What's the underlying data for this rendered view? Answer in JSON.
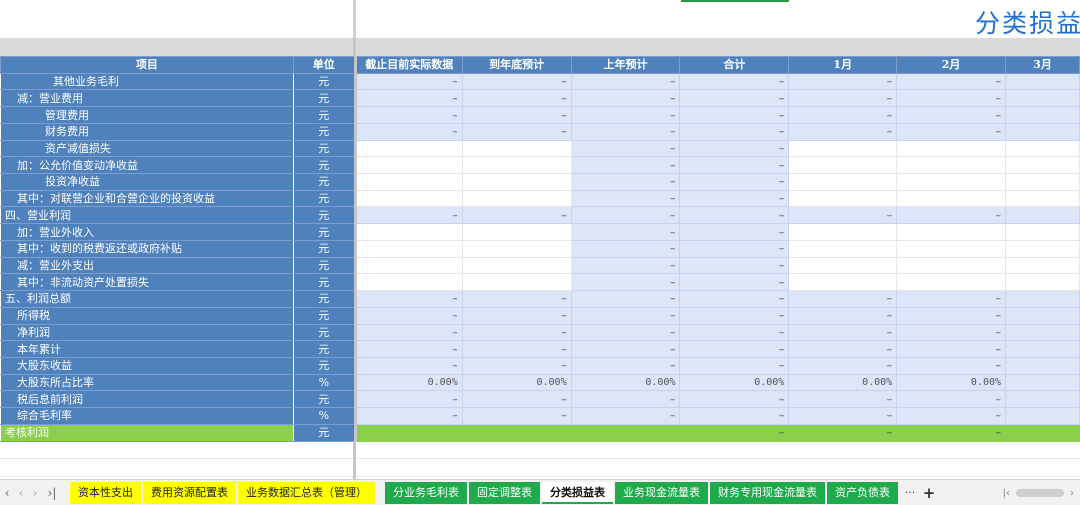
{
  "title": "分类损益",
  "columns": {
    "item": "项目",
    "unit": "单位",
    "data": [
      "截止目前实际数据",
      "到年底预计",
      "上年预计",
      "合计",
      "1月",
      "2月",
      "3月"
    ]
  },
  "rows": [
    {
      "label": "其他业务毛利",
      "unit": "元",
      "indent": "i1",
      "cells": [
        "–",
        "–",
        "–",
        "–",
        "–",
        "–",
        ""
      ],
      "fill": [
        "b",
        "b",
        "b",
        "b",
        "b",
        "b",
        "b"
      ]
    },
    {
      "label": "减：营业费用",
      "unit": "元",
      "indent": "i3",
      "cells": [
        "–",
        "–",
        "–",
        "–",
        "–",
        "–",
        ""
      ],
      "fill": [
        "b",
        "b",
        "b",
        "b",
        "b",
        "b",
        "b"
      ]
    },
    {
      "label": "管理费用",
      "unit": "元",
      "indent": "i2",
      "cells": [
        "–",
        "–",
        "–",
        "–",
        "–",
        "–",
        ""
      ],
      "fill": [
        "b",
        "b",
        "b",
        "b",
        "b",
        "b",
        "b"
      ]
    },
    {
      "label": "财务费用",
      "unit": "元",
      "indent": "i2",
      "cells": [
        "–",
        "–",
        "–",
        "–",
        "–",
        "–",
        ""
      ],
      "fill": [
        "b",
        "b",
        "b",
        "b",
        "b",
        "b",
        "b"
      ]
    },
    {
      "label": "资产减值损失",
      "unit": "元",
      "indent": "i2",
      "cells": [
        "",
        "",
        "–",
        "–",
        "",
        "",
        ""
      ],
      "fill": [
        "w",
        "w",
        "b",
        "b",
        "w",
        "w",
        "w"
      ]
    },
    {
      "label": "加：公允价值变动净收益",
      "unit": "元",
      "indent": "i3",
      "cells": [
        "",
        "",
        "–",
        "–",
        "",
        "",
        ""
      ],
      "fill": [
        "w",
        "w",
        "b",
        "b",
        "w",
        "w",
        "w"
      ]
    },
    {
      "label": "投资净收益",
      "unit": "元",
      "indent": "i2",
      "cells": [
        "",
        "",
        "–",
        "–",
        "",
        "",
        ""
      ],
      "fill": [
        "w",
        "w",
        "b",
        "b",
        "w",
        "w",
        "w"
      ]
    },
    {
      "label": "其中：对联营企业和合营企业的投资收益",
      "unit": "元",
      "indent": "i3",
      "cells": [
        "",
        "",
        "–",
        "–",
        "",
        "",
        ""
      ],
      "fill": [
        "w",
        "w",
        "b",
        "b",
        "w",
        "w",
        "w"
      ]
    },
    {
      "label": "四、营业利润",
      "unit": "元",
      "indent": "i0",
      "cells": [
        "–",
        "–",
        "–",
        "–",
        "–",
        "–",
        ""
      ],
      "fill": [
        "b",
        "b",
        "b",
        "b",
        "b",
        "b",
        "b"
      ]
    },
    {
      "label": "加：营业外收入",
      "unit": "元",
      "indent": "i3",
      "cells": [
        "",
        "",
        "–",
        "–",
        "",
        "",
        ""
      ],
      "fill": [
        "w",
        "w",
        "b",
        "b",
        "w",
        "w",
        "w"
      ]
    },
    {
      "label": "其中：收到的税费返还或政府补贴",
      "unit": "元",
      "indent": "i3",
      "cells": [
        "",
        "",
        "–",
        "–",
        "",
        "",
        ""
      ],
      "fill": [
        "w",
        "w",
        "b",
        "b",
        "w",
        "w",
        "w"
      ]
    },
    {
      "label": "减：营业外支出",
      "unit": "元",
      "indent": "i3",
      "cells": [
        "",
        "",
        "–",
        "–",
        "",
        "",
        ""
      ],
      "fill": [
        "w",
        "w",
        "b",
        "b",
        "w",
        "w",
        "w"
      ]
    },
    {
      "label": "其中：非流动资产处置损失",
      "unit": "元",
      "indent": "i3",
      "cells": [
        "",
        "",
        "–",
        "–",
        "",
        "",
        ""
      ],
      "fill": [
        "w",
        "w",
        "b",
        "b",
        "w",
        "w",
        "w"
      ]
    },
    {
      "label": "五、利润总额",
      "unit": "元",
      "indent": "i0",
      "cells": [
        "–",
        "–",
        "–",
        "–",
        "–",
        "–",
        ""
      ],
      "fill": [
        "b",
        "b",
        "b",
        "b",
        "b",
        "b",
        "b"
      ]
    },
    {
      "label": "所得税",
      "unit": "元",
      "indent": "i3",
      "cells": [
        "–",
        "–",
        "–",
        "–",
        "–",
        "–",
        ""
      ],
      "fill": [
        "b",
        "b",
        "b",
        "b",
        "b",
        "b",
        "b"
      ]
    },
    {
      "label": "净利润",
      "unit": "元",
      "indent": "i3",
      "cells": [
        "–",
        "–",
        "–",
        "–",
        "–",
        "–",
        ""
      ],
      "fill": [
        "b",
        "b",
        "b",
        "b",
        "b",
        "b",
        "b"
      ]
    },
    {
      "label": "本年累计",
      "unit": "元",
      "indent": "i3",
      "cells": [
        "–",
        "–",
        "–",
        "–",
        "–",
        "–",
        ""
      ],
      "fill": [
        "b",
        "b",
        "b",
        "b",
        "b",
        "b",
        "b"
      ]
    },
    {
      "label": "大股东收益",
      "unit": "元",
      "indent": "i3",
      "cells": [
        "–",
        "–",
        "–",
        "–",
        "–",
        "–",
        ""
      ],
      "fill": [
        "b",
        "b",
        "b",
        "b",
        "b",
        "b",
        "b"
      ]
    },
    {
      "label": "大股东所占比率",
      "unit": "%",
      "indent": "i3",
      "cells": [
        "0.00%",
        "0.00%",
        "0.00%",
        "0.00%",
        "0.00%",
        "0.00%",
        ""
      ],
      "fill": [
        "b",
        "b",
        "b",
        "b",
        "b",
        "b",
        "b"
      ]
    },
    {
      "label": "税后息前利润",
      "unit": "元",
      "indent": "i3",
      "cells": [
        "–",
        "–",
        "–",
        "–",
        "–",
        "–",
        ""
      ],
      "fill": [
        "b",
        "b",
        "b",
        "b",
        "b",
        "b",
        "b"
      ]
    },
    {
      "label": "综合毛利率",
      "unit": "%",
      "indent": "i3",
      "cells": [
        "–",
        "–",
        "–",
        "–",
        "–",
        "–",
        ""
      ],
      "fill": [
        "b",
        "b",
        "b",
        "b",
        "b",
        "b",
        "b"
      ]
    },
    {
      "label": "考核利润",
      "unit": "元",
      "indent": "i0",
      "cells": [
        "",
        "",
        "",
        "–",
        "–",
        "–",
        ""
      ],
      "fill": [
        "g",
        "g",
        "g",
        "g",
        "g",
        "g",
        "g"
      ]
    }
  ],
  "tabs": [
    {
      "label": "资本性支出",
      "style": "yellow"
    },
    {
      "label": "费用资源配置表",
      "style": "yellow"
    },
    {
      "label": "业务数据汇总表（管理）",
      "style": "yellow"
    },
    {
      "label": "分业务毛利表",
      "style": "green"
    },
    {
      "label": "固定调整表",
      "style": "green"
    },
    {
      "label": "分类损益表",
      "style": "active"
    },
    {
      "label": "业务现金流量表",
      "style": "green"
    },
    {
      "label": "财务专用现金流量表",
      "style": "green"
    },
    {
      "label": "资产负债表",
      "style": "green"
    }
  ],
  "tabbar": {
    "more": "···",
    "add": "+"
  },
  "colors": {
    "header_blue": "#4f81bd",
    "cell_blue": "#dce6f8",
    "total_green": "#8ccf4d",
    "tab_green": "#1faa4b",
    "tab_yellow": "#ffff00",
    "title_blue": "#1f6fd0"
  },
  "icons": {
    "first": "chevron-first-icon",
    "prev": "chevron-left-icon",
    "next": "chevron-right-icon",
    "last": "chevron-last-icon"
  }
}
